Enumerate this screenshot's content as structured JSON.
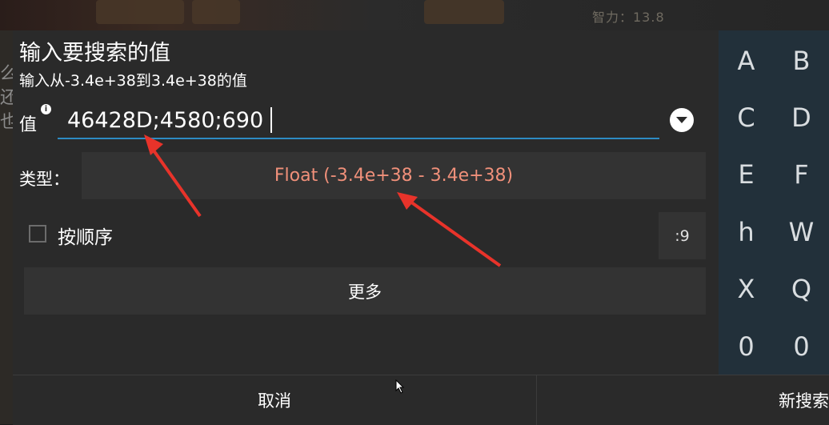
{
  "background": {
    "left_text": "么还也",
    "top_text": "智力：13.8"
  },
  "dialog": {
    "title": "输入要搜索的值",
    "subtitle": "输入从-3.4e+38到3.4e+38的值",
    "value_label": "值",
    "info_icon_glyph": "i",
    "value": "46428D;4580;690",
    "type_label": "类型：",
    "type_value": "Float (-3.4e+38 - 3.4e+38)",
    "order_label": "按顺序",
    "order_checked": false,
    "count_value": ":9",
    "more_label": "更多",
    "cancel_label": "取消",
    "search_label": "新搜索"
  },
  "keypad": {
    "keys": [
      "A",
      "B",
      "C",
      "D",
      "E",
      "F",
      "h",
      "W",
      "X",
      "Q",
      "0",
      "0"
    ]
  },
  "colors": {
    "accent_underline": "#2d8bc4",
    "type_text": "#f0907a",
    "annotation_arrow": "#e8332a",
    "keypad_bg": "#22303a"
  },
  "icons": {
    "dropdown": "chevron-down-icon",
    "info": "info-icon",
    "checkbox": "checkbox-icon",
    "cursor": "mouse-cursor-icon",
    "arrows": "annotation-arrow-icon"
  }
}
